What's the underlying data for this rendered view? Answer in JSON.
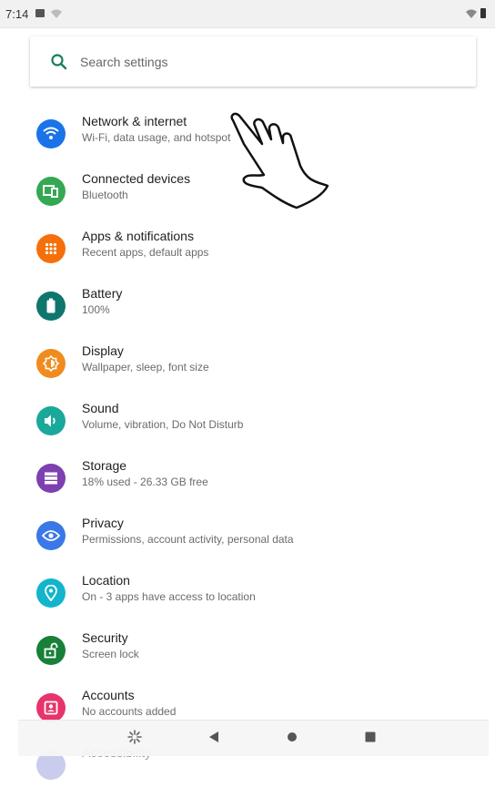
{
  "status": {
    "time": "7:14"
  },
  "search": {
    "placeholder": "Search settings"
  },
  "items": [
    {
      "title": "Network & internet",
      "subtitle": "Wi-Fi, data usage, and hotspot",
      "color": "#1a73e8",
      "icon": "wifi-icon"
    },
    {
      "title": "Connected devices",
      "subtitle": "Bluetooth",
      "color": "#34a853",
      "icon": "devices-icon"
    },
    {
      "title": "Apps & notifications",
      "subtitle": "Recent apps, default apps",
      "color": "#f5700b",
      "icon": "apps-icon"
    },
    {
      "title": "Battery",
      "subtitle": "100%",
      "color": "#0f766e",
      "icon": "battery-icon"
    },
    {
      "title": "Display",
      "subtitle": "Wallpaper, sleep, font size",
      "color": "#f08c1d",
      "icon": "brightness-icon"
    },
    {
      "title": "Sound",
      "subtitle": "Volume, vibration, Do Not Disturb",
      "color": "#1aa89b",
      "icon": "volume-icon"
    },
    {
      "title": "Storage",
      "subtitle": "18% used - 26.33 GB free",
      "color": "#7e3fb0",
      "icon": "storage-icon"
    },
    {
      "title": "Privacy",
      "subtitle": "Permissions, account activity, personal data",
      "color": "#3b78e7",
      "icon": "privacy-eye-icon"
    },
    {
      "title": "Location",
      "subtitle": "On - 3 apps have access to location",
      "color": "#12b5cb",
      "icon": "location-pin-icon"
    },
    {
      "title": "Security",
      "subtitle": "Screen lock",
      "color": "#188038",
      "icon": "lock-open-icon"
    },
    {
      "title": "Accounts",
      "subtitle": "No accounts added",
      "color": "#e8336b",
      "icon": "account-box-icon"
    },
    {
      "title": "Accessibility",
      "subtitle": "",
      "color": "#8a8fd6",
      "icon": "accessibility-icon"
    }
  ],
  "navbar": [
    "assistant-icon",
    "back-icon",
    "home-icon",
    "recents-icon"
  ]
}
